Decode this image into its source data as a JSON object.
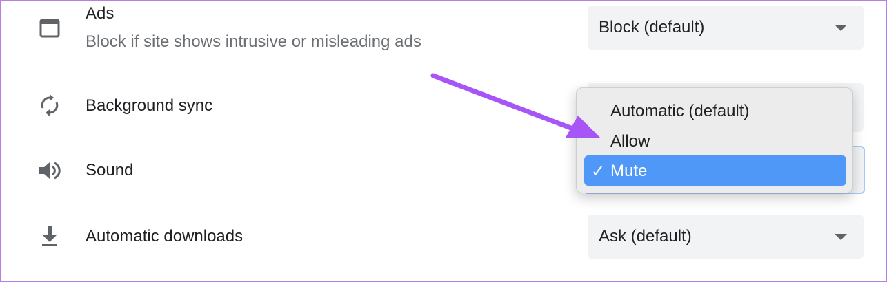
{
  "settings": [
    {
      "title": "Ads",
      "subtitle": "Block if site shows intrusive or misleading ads",
      "icon": "ads-window-icon",
      "value": "Block (default)"
    },
    {
      "title": "Background sync",
      "icon": "sync-icon"
    },
    {
      "title": "Sound",
      "icon": "speaker-icon"
    },
    {
      "title": "Automatic downloads",
      "icon": "download-icon",
      "value": "Ask (default)"
    }
  ],
  "dropdown": {
    "options": [
      {
        "label": "Automatic (default)",
        "selected": false
      },
      {
        "label": "Allow",
        "selected": false
      },
      {
        "label": "Mute",
        "selected": true
      }
    ],
    "check_glyph": "✓"
  },
  "colors": {
    "accent_arrow": "#a855f7",
    "selected_bg": "#4f98f8",
    "frame_border": "#b77ee6"
  }
}
